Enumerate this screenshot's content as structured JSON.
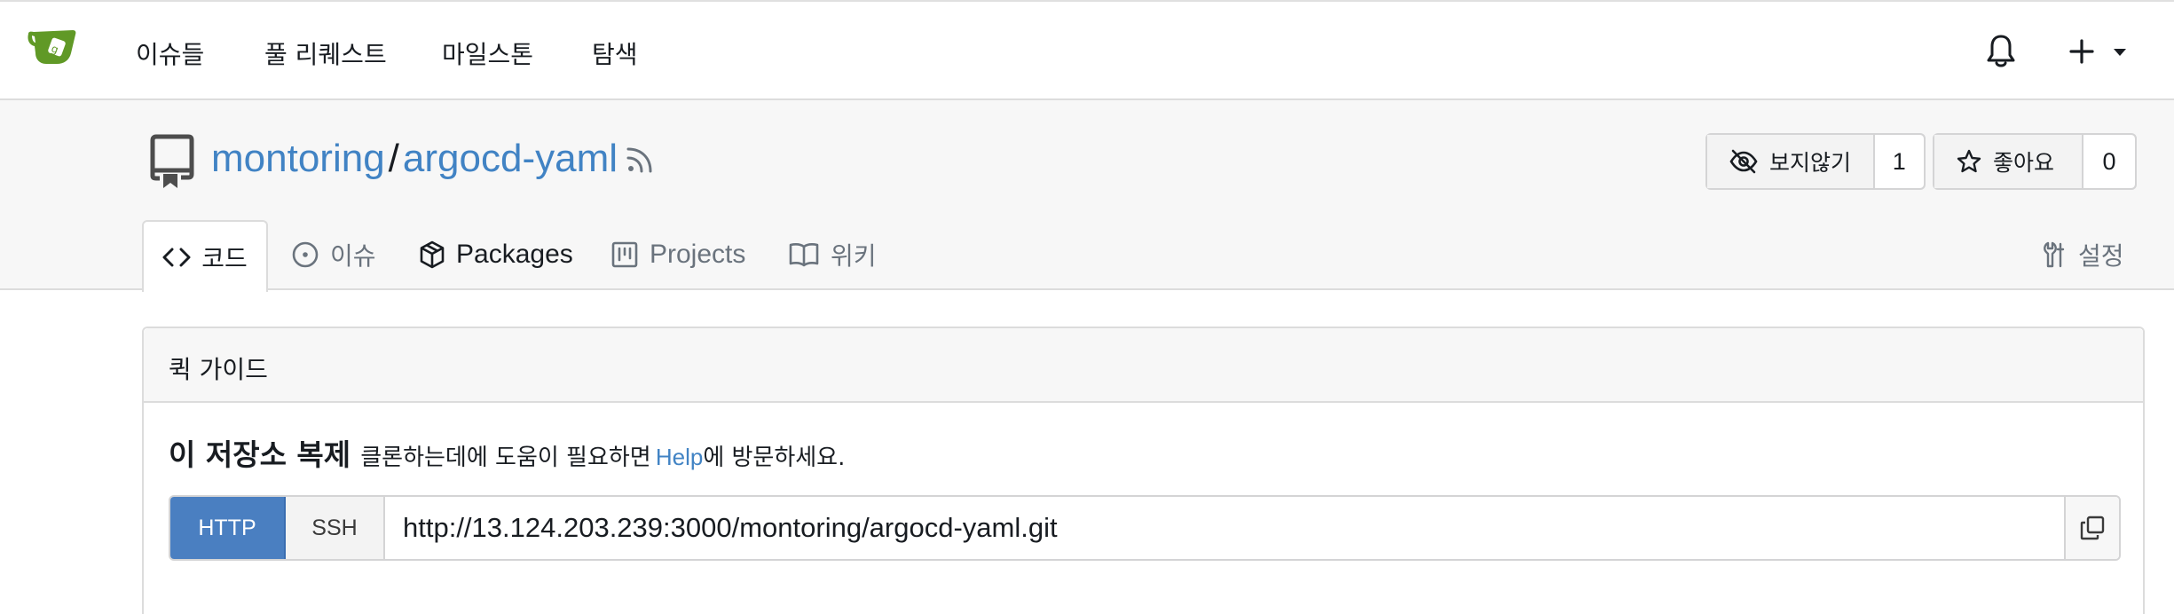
{
  "nav": {
    "links": [
      "이슈들",
      "풀 리퀘스트",
      "마일스톤",
      "탐색"
    ],
    "icons": {
      "logo": "gitea-teacup-logo",
      "notifications": "bell-icon",
      "create": "plus-icon",
      "dropdown": "caret-down-icon"
    }
  },
  "repo": {
    "owner": "montoring",
    "separator": "/",
    "name": "argocd-yaml",
    "watch": {
      "label": "보지않기",
      "count": "1"
    },
    "star": {
      "label": "좋아요",
      "count": "0"
    }
  },
  "tabs": {
    "code": "코드",
    "issues": "이슈",
    "packages": "Packages",
    "projects": "Projects",
    "wiki": "위키",
    "settings": "설정"
  },
  "quick_guide": {
    "title": "퀵 가이드",
    "clone_title": "이 저장소 복제",
    "clone_desc_before": "클론하는데에 도움이 필요하면",
    "help_link": "Help",
    "clone_desc_after": "에 방문하세요.",
    "http_label": "HTTP",
    "ssh_label": "SSH",
    "clone_url": "http://13.124.203.239:3000/montoring/argocd-yaml.git"
  },
  "colors": {
    "link": "#4183c4",
    "primary": "#4a7fc1",
    "logo_green": "#609926"
  }
}
